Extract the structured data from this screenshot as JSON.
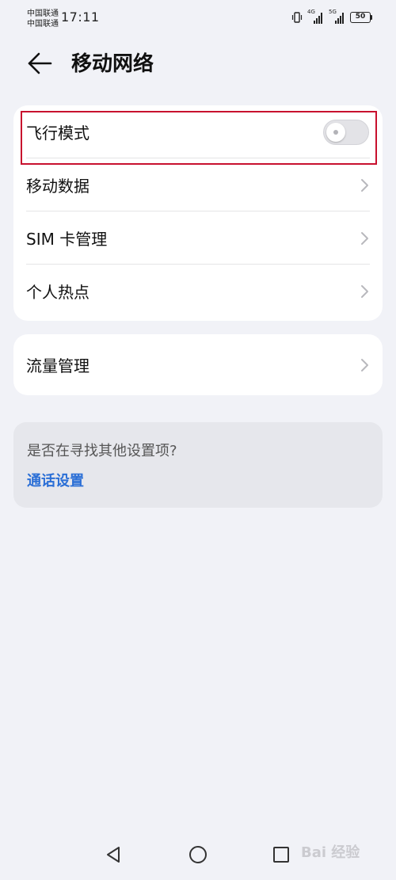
{
  "status_bar": {
    "carrier_1": "中国联通",
    "carrier_2": "中国联通",
    "time": "17:11",
    "network_1": "4G",
    "network_2": "5G",
    "battery": "50",
    "icons": [
      "vibrate-icon",
      "signal-icon",
      "signal-icon",
      "battery-icon"
    ]
  },
  "header": {
    "back_icon": "arrow-left-icon",
    "title": "移动网络"
  },
  "main_card": {
    "items": [
      {
        "label": "飞行模式",
        "control": "toggle",
        "toggle_on": false
      },
      {
        "label": "移动数据",
        "control": "chevron"
      },
      {
        "label": "SIM 卡管理",
        "control": "chevron"
      },
      {
        "label": "个人热点",
        "control": "chevron"
      }
    ]
  },
  "traffic_card": {
    "label": "流量管理",
    "control": "chevron"
  },
  "search_hint": {
    "question": "是否在寻找其他设置项?",
    "link": "通话设置"
  },
  "highlight_color": "#c8102e",
  "link_color": "#2b6fd6",
  "nav_bar": {
    "icons": [
      "triangle-back-icon",
      "circle-home-icon",
      "square-recent-icon"
    ]
  },
  "watermark": "Bai 经验"
}
